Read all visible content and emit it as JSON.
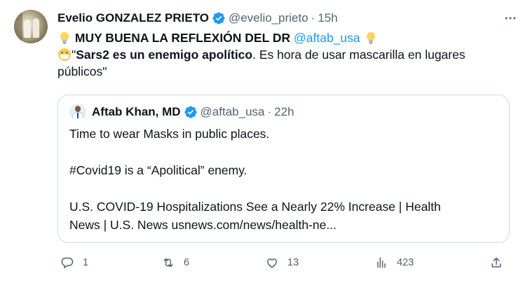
{
  "tweet": {
    "author": {
      "display_name": "Evelio GONZALEZ PRIETO",
      "handle": "@evelio_prieto",
      "time": "15h",
      "verified": true
    },
    "line1_prefix": "MUY BUENA LA REFLEXIÓN DEL DR",
    "line1_mention": "@aftab_usa",
    "line2_bold": "Sars2 es un enemigo apolítico",
    "line2_rest": ". Es hora de usar mascarilla en lugares",
    "line3": "públicos\"",
    "line2_quote_open": "\"",
    "emojis": [
      "light-bulb-icon",
      "mask-face-icon"
    ]
  },
  "quote": {
    "author": {
      "display_name": "Aftab Khan, MD",
      "handle": "@aftab_usa",
      "time": "22h",
      "verified": true
    },
    "p1": "Time to wear Masks in public places.",
    "p2": "#Covid19 is a “Apolitical” enemy.",
    "p3_line1": "U.S. COVID-19 Hospitalizations See a Nearly 22% Increase | Health",
    "p3_line2": "News | U.S. News usnews.com/news/health-ne..."
  },
  "actions": {
    "replies": "1",
    "retweets": "6",
    "likes": "13",
    "views": "423"
  },
  "colors": {
    "accent": "#1d9bf0",
    "text": "#0f1419",
    "muted": "#536471",
    "border": "#cfd9de"
  }
}
